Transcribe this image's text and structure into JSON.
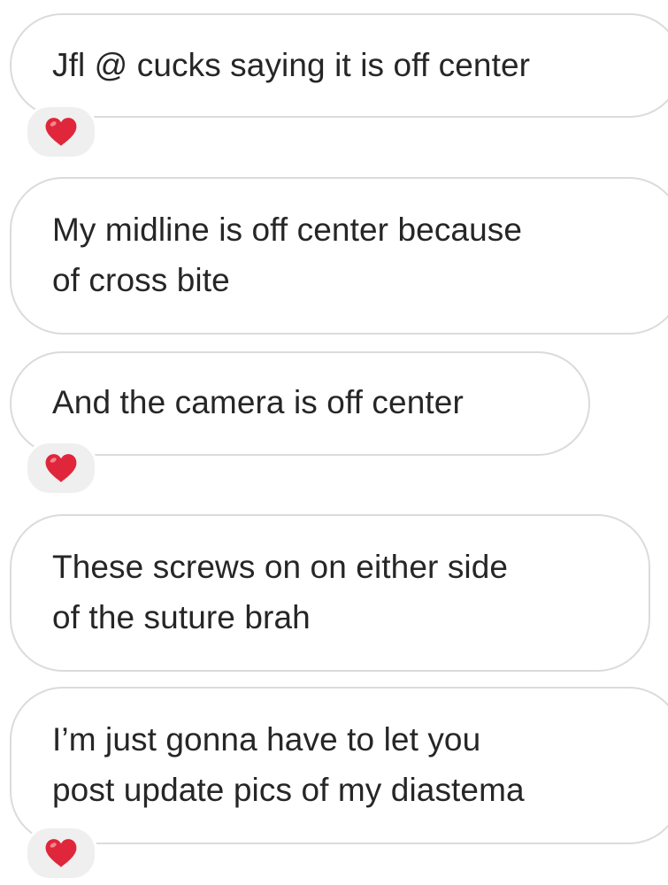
{
  "messages": [
    {
      "lines": [
        "Jfl @ cucks saying it is off center"
      ],
      "reaction": "heart-icon"
    },
    {
      "lines": [
        "My midline is off center because",
        "of cross bite"
      ],
      "reaction": null
    },
    {
      "lines": [
        "And the camera is off center"
      ],
      "reaction": "heart-icon"
    },
    {
      "lines": [
        "These screws on on either side",
        "of the suture brah"
      ],
      "reaction": null
    },
    {
      "lines": [
        "I’m just gonna have to let you",
        "post update pics of my diastema"
      ],
      "reaction": "heart-icon"
    }
  ],
  "colors": {
    "bubble_border": "#dbdbdb",
    "text": "#262626",
    "reaction_bg": "#efefef",
    "heart": "#e0263a"
  }
}
